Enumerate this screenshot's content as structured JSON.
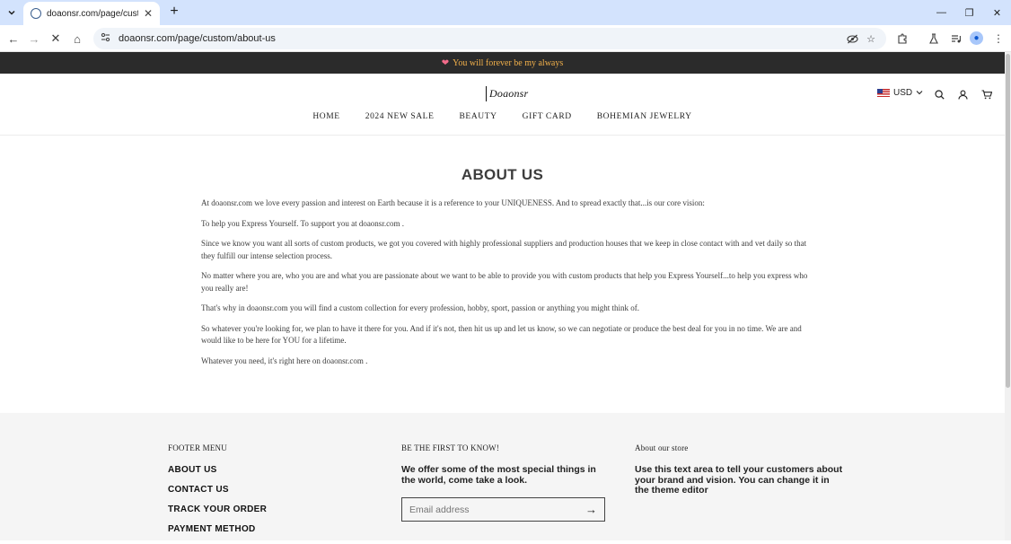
{
  "browser": {
    "tab_title": "doaonsr.com/page/custom/abo",
    "url": "doaonsr.com/page/custom/about-us",
    "window_controls": {
      "minimize": "—",
      "restore": "❐",
      "close": "✕"
    },
    "icons": {
      "tab_list": "chevron-down-icon",
      "new_tab": "+",
      "back": "←",
      "forward": "→",
      "reload": "✕",
      "home": "⌂"
    }
  },
  "announcement": {
    "heart": "❤",
    "text": "You will forever be my always"
  },
  "header": {
    "logo_text": "Doaonsr",
    "currency": "USD",
    "nav": [
      "HOME",
      "2024 NEW SALE",
      "BEAUTY",
      "GIFT CARD",
      "BOHEMIAN JEWELRY"
    ]
  },
  "page": {
    "title": "ABOUT US",
    "paragraphs": [
      "At doaonsr.com  we love every passion and interest on Earth because it is a reference to your UNIQUENESS. And to spread exactly that...is our core vision:",
      "To help you Express Yourself. To support you at doaonsr.com .",
      "Since we know you want all sorts of custom products, we got you covered with highly professional suppliers and production houses that we keep in close contact with and vet daily so that they fulfill our intense selection process.",
      "No matter where you are, who you are and what you are passionate about we want to be able to provide you with custom products that help you Express Yourself...to help you express who you really are!",
      "That's why in doaonsr.com  you will find a custom collection for every profession, hobby, sport, passion or anything you might think of.",
      "So whatever you're looking for, we plan to have it there for you. And if it's not, then hit us up and let us know, so we can negotiate or produce the best deal for you in no time. We are and would like to be here for YOU for a lifetime.",
      "Whatever you need, it's right here on doaonsr.com ."
    ]
  },
  "footer": {
    "menu_heading": "FOOTER MENU",
    "menu_links": [
      "ABOUT US",
      "CONTACT US",
      "TRACK YOUR ORDER",
      "PAYMENT METHOD"
    ],
    "newsletter_heading": "BE THE FIRST TO KNOW!",
    "newsletter_text": "We offer some of the most special things in the world, come take a look.",
    "email_placeholder": "Email address",
    "about_heading": "About our store",
    "about_text": "Use this text area to tell your customers about your brand and vision. You can change it in the theme editor"
  }
}
